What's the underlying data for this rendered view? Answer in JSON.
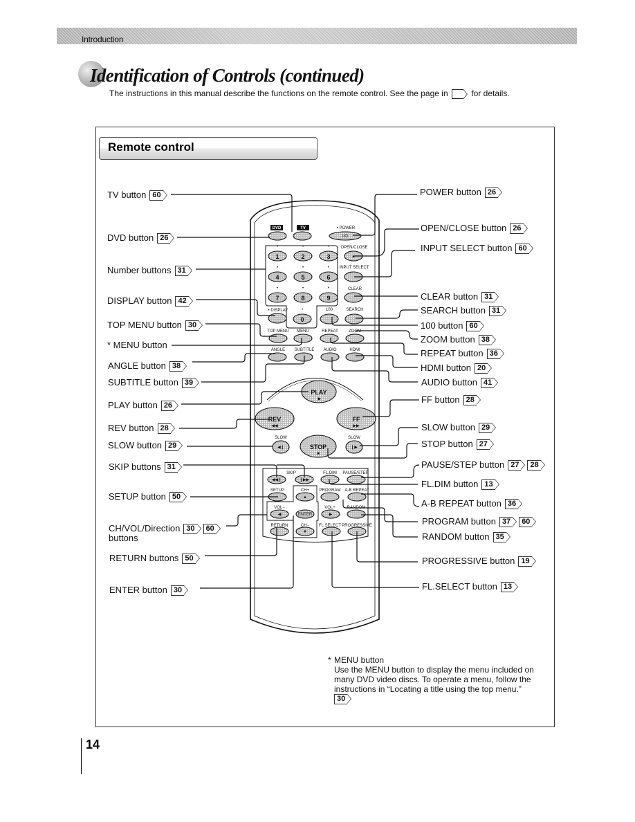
{
  "header": {
    "section": "Introduction"
  },
  "title": "Identification of Controls (continued)",
  "subtitle_before": "The instructions in this manual describe the functions on the remote control. See the page in",
  "subtitle_after": "for details.",
  "section_heading": "Remote control",
  "left_labels": [
    {
      "name": "tv-button",
      "text": "TV button",
      "refs": [
        "60"
      ]
    },
    {
      "name": "dvd-button",
      "text": "DVD button",
      "refs": [
        "26"
      ]
    },
    {
      "name": "number-buttons",
      "text": "Number buttons",
      "refs": [
        "31"
      ]
    },
    {
      "name": "display-button",
      "text": "DISPLAY button",
      "refs": [
        "42"
      ]
    },
    {
      "name": "top-menu-button",
      "text": "TOP MENU button",
      "refs": [
        "30"
      ]
    },
    {
      "name": "menu-button",
      "text": "* MENU button",
      "refs": []
    },
    {
      "name": "angle-button",
      "text": "ANGLE button",
      "refs": [
        "38"
      ]
    },
    {
      "name": "subtitle-button",
      "text": "SUBTITLE button",
      "refs": [
        "39"
      ]
    },
    {
      "name": "play-button",
      "text": "PLAY button",
      "refs": [
        "26"
      ]
    },
    {
      "name": "rev-button",
      "text": "REV button",
      "refs": [
        "28"
      ]
    },
    {
      "name": "slow-button-left",
      "text": "SLOW button",
      "refs": [
        "29"
      ]
    },
    {
      "name": "skip-buttons",
      "text": "SKIP buttons",
      "refs": [
        "31"
      ]
    },
    {
      "name": "setup-button",
      "text": "SETUP button",
      "refs": [
        "50"
      ]
    },
    {
      "name": "ch-vol-direction-buttons",
      "text": "CH/VOL/Direction",
      "text2": "buttons",
      "refs": [
        "30",
        "60"
      ]
    },
    {
      "name": "return-buttons",
      "text": "RETURN buttons",
      "refs": [
        "50"
      ]
    },
    {
      "name": "enter-button",
      "text": "ENTER button",
      "refs": [
        "30"
      ]
    }
  ],
  "right_labels": [
    {
      "name": "power-button",
      "text": "POWER button",
      "refs": [
        "26"
      ]
    },
    {
      "name": "open-close-button",
      "text": "OPEN/CLOSE button",
      "refs": [
        "26"
      ]
    },
    {
      "name": "input-select-button",
      "text": "INPUT SELECT button",
      "refs": [
        "60"
      ]
    },
    {
      "name": "clear-button",
      "text": "CLEAR button",
      "refs": [
        "31"
      ]
    },
    {
      "name": "search-button",
      "text": "SEARCH button",
      "refs": [
        "31"
      ]
    },
    {
      "name": "100-button",
      "text": "100 button",
      "refs": [
        "60"
      ]
    },
    {
      "name": "zoom-button",
      "text": "ZOOM button",
      "refs": [
        "38"
      ]
    },
    {
      "name": "repeat-button",
      "text": "REPEAT button",
      "refs": [
        "36"
      ]
    },
    {
      "name": "hdmi-button",
      "text": "HDMI button",
      "refs": [
        "20"
      ]
    },
    {
      "name": "audio-button",
      "text": "AUDIO button",
      "refs": [
        "41"
      ]
    },
    {
      "name": "ff-button",
      "text": "FF button",
      "refs": [
        "28"
      ]
    },
    {
      "name": "slow-button-right",
      "text": "SLOW button",
      "refs": [
        "29"
      ]
    },
    {
      "name": "stop-button",
      "text": "STOP button",
      "refs": [
        "27"
      ]
    },
    {
      "name": "pause-step-button",
      "text": "PAUSE/STEP button",
      "refs": [
        "27",
        "28"
      ]
    },
    {
      "name": "fl-dim-button",
      "text": "FL.DIM button",
      "refs": [
        "13"
      ]
    },
    {
      "name": "a-b-repeat-button",
      "text": "A-B REPEAT button",
      "refs": [
        "36"
      ]
    },
    {
      "name": "program-button",
      "text": "PROGRAM button",
      "refs": [
        "37",
        "60"
      ]
    },
    {
      "name": "random-button",
      "text": "RANDOM button",
      "refs": [
        "35"
      ]
    },
    {
      "name": "progressive-button",
      "text": "PROGRESSIVE button",
      "refs": [
        "19"
      ]
    },
    {
      "name": "fl-select-button",
      "text": "FL.SELECT button",
      "refs": [
        "13"
      ]
    }
  ],
  "remote": {
    "dvd": "DVD",
    "tv": "TV",
    "power": "• POWER",
    "power_glyph": "I/ტ",
    "open_close": "OPEN/CLOSE",
    "input_select": "INPUT SELECT",
    "clear": "CLEAR",
    "display": "• DISPLAY",
    "hundred": "100",
    "search": "SEARCH",
    "digits": [
      "1",
      "2",
      "3",
      "4",
      "5",
      "6",
      "7",
      "8",
      "9",
      "0"
    ],
    "top_menu": "TOP MENU",
    "menu": "MENU",
    "repeat": "REPEAT",
    "zoom": "ZOOM",
    "angle": "ANGLE",
    "subtitle": "SUBTITLE",
    "audio": "AUDIO",
    "hdmi": "HDMI",
    "play": "PLAY",
    "rev": "REV",
    "ff": "FF",
    "stop": "STOP",
    "slow": "SLOW",
    "skip": "SKIP",
    "fl_dim": "FL.DIM",
    "pause_step": "PAUSE/STEP",
    "setup": "SETUP",
    "ch_plus": "CH+",
    "program": "PROGRAM",
    "ab_repeat": "A-B REPEAT",
    "vol_minus": "VOL−",
    "vol_plus": "VOL+",
    "random": "RANDOM",
    "enter": "ENTER",
    "return": "RETURN",
    "ch_minus": "CH−",
    "fl_select": "FL.SELECT",
    "progressive": "PROGRESSIVE"
  },
  "footnote": {
    "star": "*",
    "title": "MENU button",
    "body": "Use the MENU button to display the menu included on many DVD video discs. To operate a menu, follow the instructions in “Locating a title using the top menu.”",
    "ref": "30"
  },
  "page_number": "14"
}
